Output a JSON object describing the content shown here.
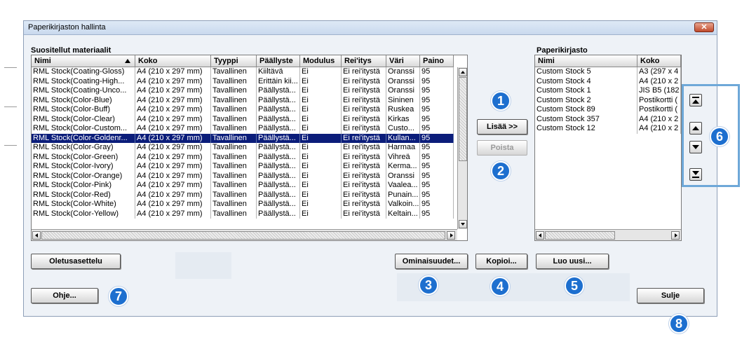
{
  "window": {
    "title": "Paperikirjaston hallinta",
    "close_glyph": "✕"
  },
  "recommended": {
    "label": "Suositellut materiaalit",
    "columns": [
      "Nimi",
      "Koko",
      "Tyyppi",
      "Päällyste",
      "Modulus",
      "Rei'itys",
      "Väri",
      "Paino"
    ],
    "sorted_column": "Nimi",
    "selected_row": 7,
    "rows": [
      [
        "RML Stock(Coating-Gloss)",
        "A4 (210 x 297 mm)",
        "Tavallinen",
        "Kiiltävä",
        "Ei",
        "Ei rei'itystä",
        "Oranssi",
        "95"
      ],
      [
        "RML Stock(Coating-High...",
        "A4 (210 x 297 mm)",
        "Tavallinen",
        "Erittäin kii...",
        "Ei",
        "Ei rei'itystä",
        "Oranssi",
        "95"
      ],
      [
        "RML Stock(Coating-Unco...",
        "A4 (210 x 297 mm)",
        "Tavallinen",
        "Päällystä...",
        "Ei",
        "Ei rei'itystä",
        "Oranssi",
        "95"
      ],
      [
        "RML Stock(Color-Blue)",
        "A4 (210 x 297 mm)",
        "Tavallinen",
        "Päällystä...",
        "Ei",
        "Ei rei'itystä",
        "Sininen",
        "95"
      ],
      [
        "RML Stock(Color-Buff)",
        "A4 (210 x 297 mm)",
        "Tavallinen",
        "Päällystä...",
        "Ei",
        "Ei rei'itystä",
        "Ruskea",
        "95"
      ],
      [
        "RML Stock(Color-Clear)",
        "A4 (210 x 297 mm)",
        "Tavallinen",
        "Päällystä...",
        "Ei",
        "Ei rei'itystä",
        "Kirkas",
        "95"
      ],
      [
        "RML Stock(Color-Custom...",
        "A4 (210 x 297 mm)",
        "Tavallinen",
        "Päällystä...",
        "Ei",
        "Ei rei'itystä",
        "Custo...",
        "95"
      ],
      [
        "RML Stock(Color-Goldenr...",
        "A4 (210 x 297 mm)",
        "Tavallinen",
        "Päällystä...",
        "Ei",
        "Ei rei'itystä",
        "Kullan...",
        "95"
      ],
      [
        "RML Stock(Color-Gray)",
        "A4 (210 x 297 mm)",
        "Tavallinen",
        "Päällystä...",
        "Ei",
        "Ei rei'itystä",
        "Harmaa",
        "95"
      ],
      [
        "RML Stock(Color-Green)",
        "A4 (210 x 297 mm)",
        "Tavallinen",
        "Päällystä...",
        "Ei",
        "Ei rei'itystä",
        "Vihreä",
        "95"
      ],
      [
        "RML Stock(Color-Ivory)",
        "A4 (210 x 297 mm)",
        "Tavallinen",
        "Päällystä...",
        "Ei",
        "Ei rei'itystä",
        "Kerma...",
        "95"
      ],
      [
        "RML Stock(Color-Orange)",
        "A4 (210 x 297 mm)",
        "Tavallinen",
        "Päällystä...",
        "Ei",
        "Ei rei'itystä",
        "Oranssi",
        "95"
      ],
      [
        "RML Stock(Color-Pink)",
        "A4 (210 x 297 mm)",
        "Tavallinen",
        "Päällystä...",
        "Ei",
        "Ei rei'itystä",
        "Vaalea...",
        "95"
      ],
      [
        "RML Stock(Color-Red)",
        "A4 (210 x 297 mm)",
        "Tavallinen",
        "Päällystä...",
        "Ei",
        "Ei rei'itystä",
        "Punain...",
        "95"
      ],
      [
        "RML Stock(Color-White)",
        "A4 (210 x 297 mm)",
        "Tavallinen",
        "Päällystä...",
        "Ei",
        "Ei rei'itystä",
        "Valkoin...",
        "95"
      ],
      [
        "RML Stock(Color-Yellow)",
        "A4 (210 x 297 mm)",
        "Tavallinen",
        "Päällystä...",
        "Ei",
        "Ei rei'itystä",
        "Keltain...",
        "95"
      ]
    ]
  },
  "library": {
    "label": "Paperikirjasto",
    "columns": [
      "Nimi",
      "Koko"
    ],
    "rows": [
      [
        "Custom Stock 5",
        "A3 (297 x 4"
      ],
      [
        "Custom Stock 4",
        "A4 (210 x 2"
      ],
      [
        "Custom Stock 1",
        "JIS B5 (182"
      ],
      [
        "Custom Stock 2",
        "Postikortti ("
      ],
      [
        "Custom Stock 89",
        "Postikortti ("
      ],
      [
        "Custom Stock 357",
        "A4 (210 x 2"
      ],
      [
        "Custom Stock 12",
        "A4 (210 x 2"
      ]
    ]
  },
  "buttons": {
    "add": "Lisää >>",
    "remove": "Poista",
    "default_layout": "Oletusasettelu",
    "properties": "Ominaisuudet...",
    "copy": "Kopioi...",
    "create_new": "Luo uusi...",
    "help": "Ohje...",
    "close": "Sulje"
  },
  "callouts": [
    "1",
    "2",
    "3",
    "4",
    "5",
    "6",
    "7",
    "8"
  ],
  "icons": {
    "move_top": "move-to-top-icon",
    "move_up": "move-up-icon",
    "move_down": "move-down-icon",
    "move_bottom": "move-to-bottom-icon"
  },
  "colors": {
    "selection": "#0b1d7a",
    "callout": "#1d6fcf",
    "frame": "#6ea8d8",
    "close": "#c04a2c"
  }
}
